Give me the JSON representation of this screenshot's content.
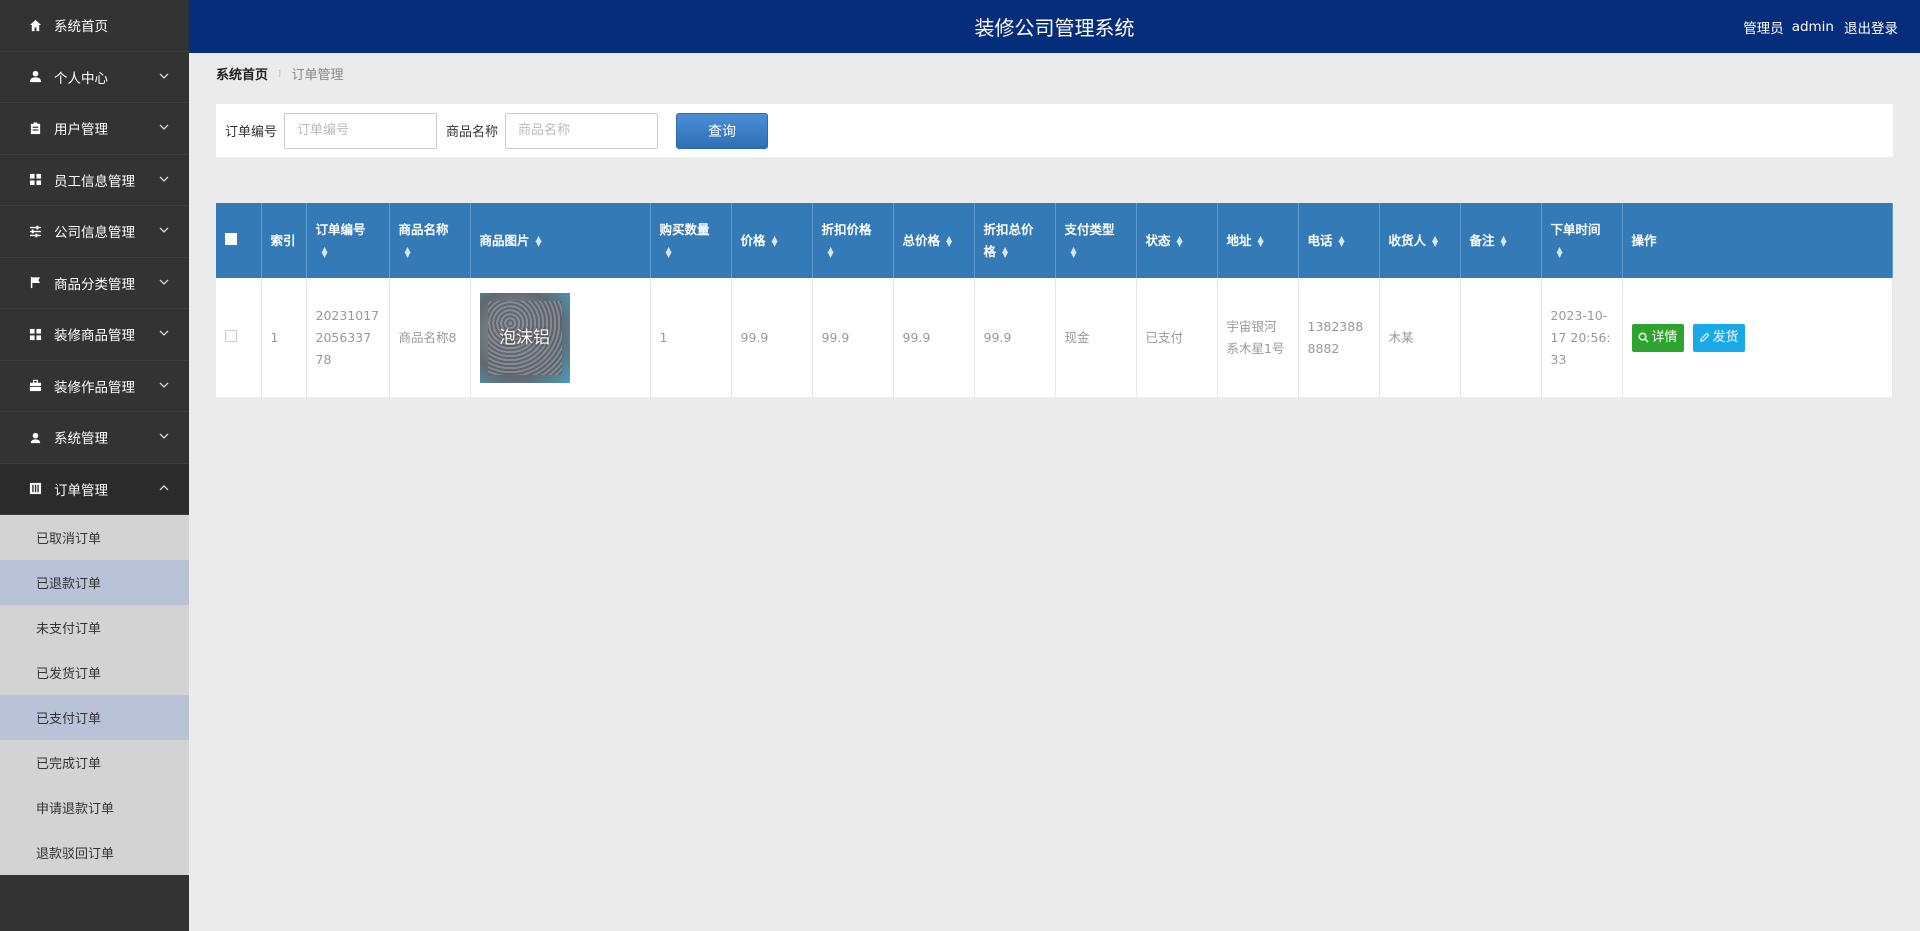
{
  "app": {
    "title": "装修公司管理系统"
  },
  "header": {
    "role": "管理员",
    "username": "admin",
    "logout": "退出登录"
  },
  "sidebar": {
    "items": [
      {
        "label": "系统首页",
        "icon": "home-icon",
        "has_caret": false
      },
      {
        "label": "个人中心",
        "icon": "user-icon",
        "has_caret": true
      },
      {
        "label": "用户管理",
        "icon": "user-admin-icon",
        "has_caret": true
      },
      {
        "label": "员工信息管理",
        "icon": "grid-icon",
        "has_caret": true
      },
      {
        "label": "公司信息管理",
        "icon": "sliders-icon",
        "has_caret": true
      },
      {
        "label": "商品分类管理",
        "icon": "flag-icon",
        "has_caret": true
      },
      {
        "label": "装修商品管理",
        "icon": "grid-icon",
        "has_caret": true
      },
      {
        "label": "装修作品管理",
        "icon": "briefcase-icon",
        "has_caret": true
      },
      {
        "label": "系统管理",
        "icon": "user-gear-icon",
        "has_caret": true
      },
      {
        "label": "订单管理",
        "icon": "clipboard-icon",
        "has_caret": true
      }
    ],
    "sub_items": [
      {
        "label": "已取消订单"
      },
      {
        "label": "已退款订单"
      },
      {
        "label": "未支付订单"
      },
      {
        "label": "已发货订单"
      },
      {
        "label": "已支付订单"
      },
      {
        "label": "已完成订单"
      },
      {
        "label": "申请退款订单"
      },
      {
        "label": "退款驳回订单"
      }
    ]
  },
  "breadcrumb": {
    "home": "系统首页",
    "current": "订单管理"
  },
  "search": {
    "order_no_label": "订单编号",
    "order_no_placeholder": "订单编号",
    "order_no_value": "",
    "product_name_label": "商品名称",
    "product_name_placeholder": "商品名称",
    "product_name_value": "",
    "button": "查询"
  },
  "table": {
    "headers": [
      "索引",
      "订单编号",
      "商品名称",
      "商品图片",
      "购买数量",
      "价格",
      "折扣价格",
      "总价格",
      "折扣总价格",
      "支付类型",
      "状态",
      "地址",
      "电话",
      "收货人",
      "备注",
      "下单时间",
      "操作"
    ],
    "rows": [
      {
        "index": "1",
        "order_no": "202310172056337 78",
        "product_name": "商品名称8",
        "image_text": "泡沫铝",
        "quantity": "1",
        "price": "99.9",
        "discount_price": "99.9",
        "total_price": "99.9",
        "discount_total": "99.9",
        "pay_type": "现金",
        "status": "已支付",
        "address": "宇宙银河系木星1号",
        "phone": "13823888882",
        "receiver": "木某",
        "remark": "",
        "order_time": "2023-10-17 20:56:33",
        "detail_btn": "详情",
        "ship_btn": "发货"
      }
    ]
  },
  "colors": {
    "header_bg": "#052d7c",
    "table_head_bg": "#337ab7",
    "sidebar_bg": "#333333",
    "btn_green": "#2ea32e",
    "btn_blue": "#1aa9e8"
  }
}
